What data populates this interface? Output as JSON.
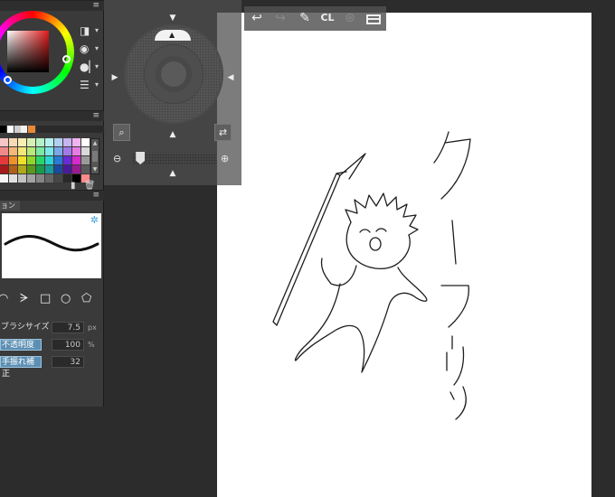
{
  "panels": {
    "menu_glyph": "≡"
  },
  "color": {
    "main_hue_color": "#e21b1b",
    "mode_icons": [
      {
        "name": "color-square-mode-icon",
        "glyph": "◨"
      },
      {
        "name": "play-mode-icon",
        "glyph": "◉"
      },
      {
        "name": "dot-mode-icon",
        "glyph": "●▏"
      },
      {
        "name": "list-mode-icon",
        "glyph": "☰"
      }
    ],
    "caret": "▾"
  },
  "swatches": {
    "strip": [
      "#000000",
      "#ffffff",
      "#cfcfcf",
      "#f2f2f2",
      "#e8893a",
      "#2a2a2a"
    ],
    "grid": [
      "#f5c6c6",
      "#f7d9b5",
      "#f7f0b3",
      "#d6f0b3",
      "#b3f0c6",
      "#b3f0ef",
      "#b3cff0",
      "#c6b3f0",
      "#efb3f0",
      "#ffffff",
      "#f08a8a",
      "#f5b878",
      "#f2e87a",
      "#b8e878",
      "#7ae8a0",
      "#7ae8e6",
      "#7aa8e8",
      "#a07ae8",
      "#e87ae4",
      "#d9d9d9",
      "#e63a3a",
      "#f0902a",
      "#ede02a",
      "#8fd62a",
      "#2ad66a",
      "#2ad6d4",
      "#2a7ad6",
      "#6a2ad6",
      "#d62acc",
      "#9a9a9a",
      "#a31a1a",
      "#b0601a",
      "#b0a81a",
      "#5a9a1a",
      "#1a9a4a",
      "#1a9a98",
      "#1a4a9a",
      "#4a1a9a",
      "#9a1a92",
      "#5a5a5a",
      "#f5f5f5",
      "#e0e0e0",
      "#c2c2c2",
      "#a3a3a3",
      "#858585",
      "#666666",
      "#474747",
      "#292929",
      "#000000",
      "#ff8a8a"
    ],
    "actions": [
      "▮",
      "🗑"
    ]
  },
  "brush": {
    "tab_label": "ョン",
    "gear": "✲",
    "tip_shapes": [
      "◠",
      "ᗔ",
      "□",
      "○",
      "⬠"
    ],
    "properties": [
      {
        "label": "ブラシサイズ",
        "value": "7.5",
        "unit": "px",
        "boxed": false
      },
      {
        "label": "不透明度",
        "value": "100",
        "unit": "%",
        "boxed": true
      },
      {
        "label": "手振れ補正",
        "value": "32",
        "unit": "",
        "boxed": true
      }
    ]
  },
  "navigator": {
    "up": "▲",
    "down": "▼",
    "left": "◀",
    "right": "▶",
    "rotate_indicator": "▲",
    "fit_icon": "⌕",
    "flip_icon": "⇄",
    "zoom_out": "⊖",
    "zoom_in": "⊕",
    "zoom_level": 0.05
  },
  "toolbar": {
    "undo": "↩",
    "redo": "↪",
    "pen": "✎",
    "clear": "CL",
    "snap": "⊛"
  },
  "canvas": {
    "background": "#ffffff"
  }
}
